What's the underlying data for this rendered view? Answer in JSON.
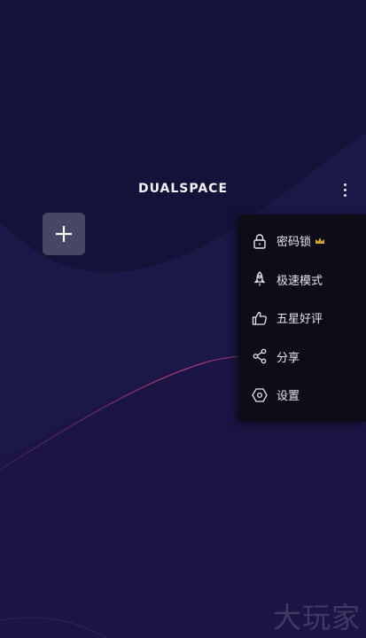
{
  "app": {
    "logo_text": "DUALSPACE"
  },
  "header": {
    "more_icon": "more-vertical-icon"
  },
  "main": {
    "add_icon": "plus-icon"
  },
  "menu": {
    "items": [
      {
        "label": "密码锁",
        "icon": "lock-icon",
        "badge_icon": "crown-icon"
      },
      {
        "label": "极速模式",
        "icon": "rocket-icon"
      },
      {
        "label": "五星好评",
        "icon": "thumbs-up-icon"
      },
      {
        "label": "分享",
        "icon": "share-icon"
      },
      {
        "label": "设置",
        "icon": "settings-hexagon-icon"
      }
    ]
  },
  "watermark": {
    "text": "大玩家"
  },
  "colors": {
    "background": "#17133a",
    "menu_background": "#0d0d18",
    "crown": "#d4a52a",
    "accent_line": "#b0306a"
  }
}
